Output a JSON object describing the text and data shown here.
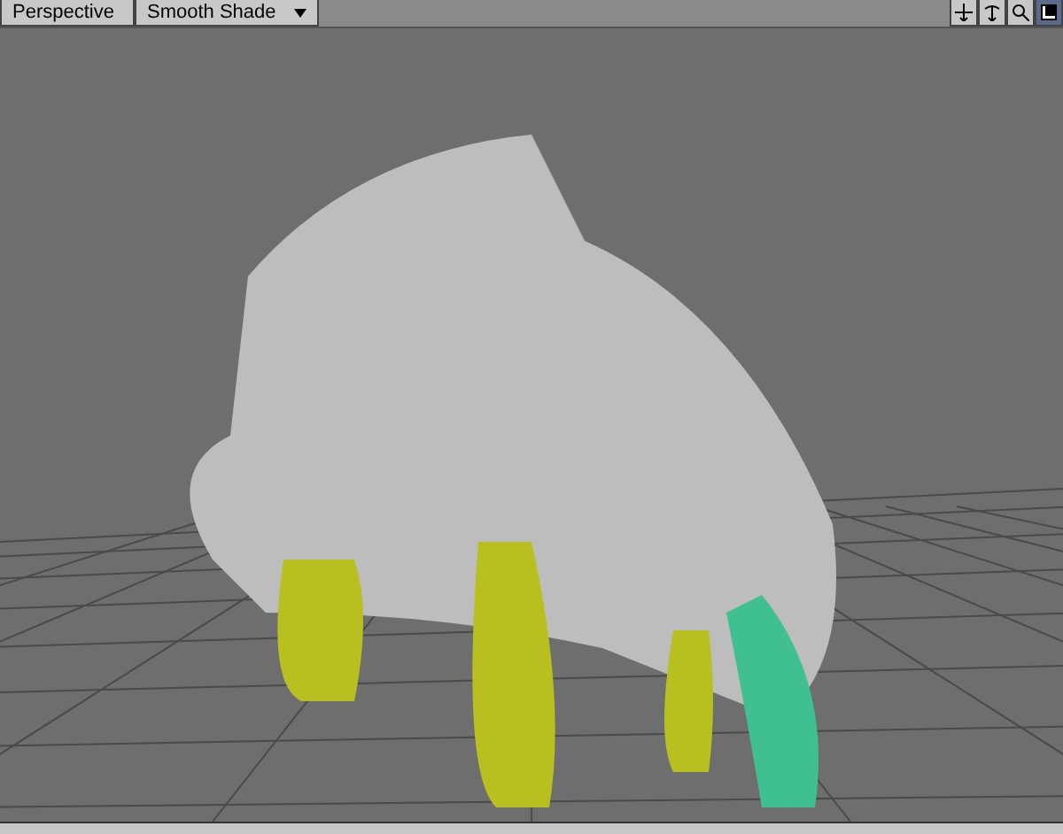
{
  "viewport": {
    "view_menu": "Perspective",
    "shading_menu": "Smooth Shade"
  }
}
